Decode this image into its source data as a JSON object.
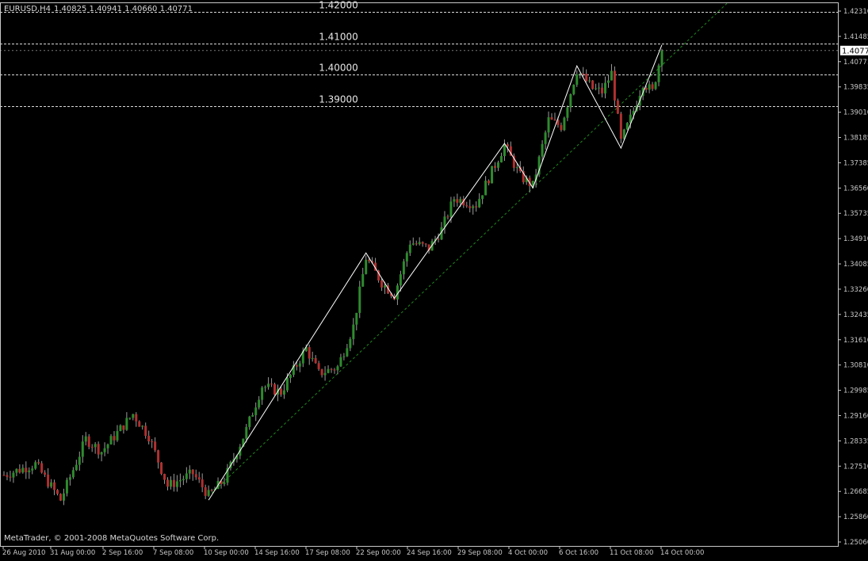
{
  "header": {
    "symbol_timeframe": "EURUSD,H4",
    "ohlc": "1.40825 1.40941 1.40660 1.40771"
  },
  "footer": {
    "copyright": "MetaTrader, © 2001-2008 MetaQuotes Software Corp."
  },
  "current_price_label": "1.40771",
  "colors": {
    "background": "#000000",
    "frame": "#c8c8c8",
    "axis_text": "#c8c8c8",
    "bull": "#2e8b2e",
    "bear": "#b03030",
    "wick": "#9a9a9a",
    "zigzag": "#ffffff",
    "trendline": "#1f8a1f",
    "level_lines": "#ffffff",
    "price_tag_bg": "#ffffff",
    "price_tag_fg": "#000000"
  },
  "chart_data": {
    "type": "candlestick",
    "symbol": "EURUSD",
    "timeframe": "H4",
    "x_tick_labels": [
      "26 Aug 2010",
      "31 Aug 00:00",
      "2 Sep 16:00",
      "7 Sep 08:00",
      "10 Sep 00:00",
      "14 Sep 16:00",
      "17 Sep 08:00",
      "22 Sep 00:00",
      "24 Sep 16:00",
      "29 Sep 08:00",
      "4 Oct 00:00",
      "6 Oct 16:00",
      "11 Oct 08:00",
      "14 Oct 00:00"
    ],
    "y_tick_labels": [
      "1.42310",
      "1.41485",
      "1.40771",
      "1.39835",
      "1.39010",
      "1.38185",
      "1.37385",
      "1.36560",
      "1.35735",
      "1.34910",
      "1.34085",
      "1.33260",
      "1.32435",
      "1.31610",
      "1.30810",
      "1.29985",
      "1.29160",
      "1.28335",
      "1.27510",
      "1.26685",
      "1.25860",
      "1.25060"
    ],
    "ylim": [
      1.2506,
      1.4231
    ],
    "level_lines": [
      1.42,
      1.41,
      1.4,
      1.39
    ],
    "level_labels": [
      "1.42000",
      "1.41000",
      "1.40000",
      "1.39000"
    ],
    "current_price": 1.40771,
    "zigzag_points": [
      {
        "bar": 65,
        "price": 1.264
      },
      {
        "bar": 115,
        "price": 1.343
      },
      {
        "bar": 124,
        "price": 1.3285
      },
      {
        "bar": 159,
        "price": 1.378
      },
      {
        "bar": 168,
        "price": 1.3638
      },
      {
        "bar": 182,
        "price": 1.4028
      },
      {
        "bar": 196,
        "price": 1.3765
      },
      {
        "bar": 209,
        "price": 1.4095
      }
    ],
    "trendline": [
      {
        "bar": 66,
        "price": 1.2662
      },
      {
        "bar": 230,
        "price": 1.4231
      }
    ],
    "grid": false,
    "legend": "none",
    "anchors": [
      {
        "bar": 0,
        "price": 1.272
      },
      {
        "bar": 10,
        "price": 1.2755
      },
      {
        "bar": 18,
        "price": 1.264
      },
      {
        "bar": 26,
        "price": 1.2835
      },
      {
        "bar": 31,
        "price": 1.2795
      },
      {
        "bar": 41,
        "price": 1.2915
      },
      {
        "bar": 46,
        "price": 1.2845
      },
      {
        "bar": 52,
        "price": 1.2685
      },
      {
        "bar": 60,
        "price": 1.2725
      },
      {
        "bar": 65,
        "price": 1.2655
      },
      {
        "bar": 70,
        "price": 1.2705
      },
      {
        "bar": 77,
        "price": 1.2865
      },
      {
        "bar": 82,
        "price": 1.3005
      },
      {
        "bar": 88,
        "price": 1.2985
      },
      {
        "bar": 96,
        "price": 1.3125
      },
      {
        "bar": 100,
        "price": 1.3045
      },
      {
        "bar": 106,
        "price": 1.3065
      },
      {
        "bar": 111,
        "price": 1.3195
      },
      {
        "bar": 115,
        "price": 1.3415
      },
      {
        "bar": 120,
        "price": 1.3335
      },
      {
        "bar": 124,
        "price": 1.3295
      },
      {
        "bar": 129,
        "price": 1.3465
      },
      {
        "bar": 135,
        "price": 1.3445
      },
      {
        "bar": 139,
        "price": 1.3505
      },
      {
        "bar": 143,
        "price": 1.3605
      },
      {
        "bar": 150,
        "price": 1.3585
      },
      {
        "bar": 159,
        "price": 1.3775
      },
      {
        "bar": 164,
        "price": 1.3675
      },
      {
        "bar": 168,
        "price": 1.3645
      },
      {
        "bar": 173,
        "price": 1.3855
      },
      {
        "bar": 177,
        "price": 1.3835
      },
      {
        "bar": 182,
        "price": 1.4015
      },
      {
        "bar": 187,
        "price": 1.3955
      },
      {
        "bar": 190,
        "price": 1.3945
      },
      {
        "bar": 193,
        "price": 1.4005
      },
      {
        "bar": 196,
        "price": 1.3785
      },
      {
        "bar": 200,
        "price": 1.3885
      },
      {
        "bar": 203,
        "price": 1.3975
      },
      {
        "bar": 206,
        "price": 1.3945
      },
      {
        "bar": 209,
        "price": 1.4077
      }
    ]
  }
}
